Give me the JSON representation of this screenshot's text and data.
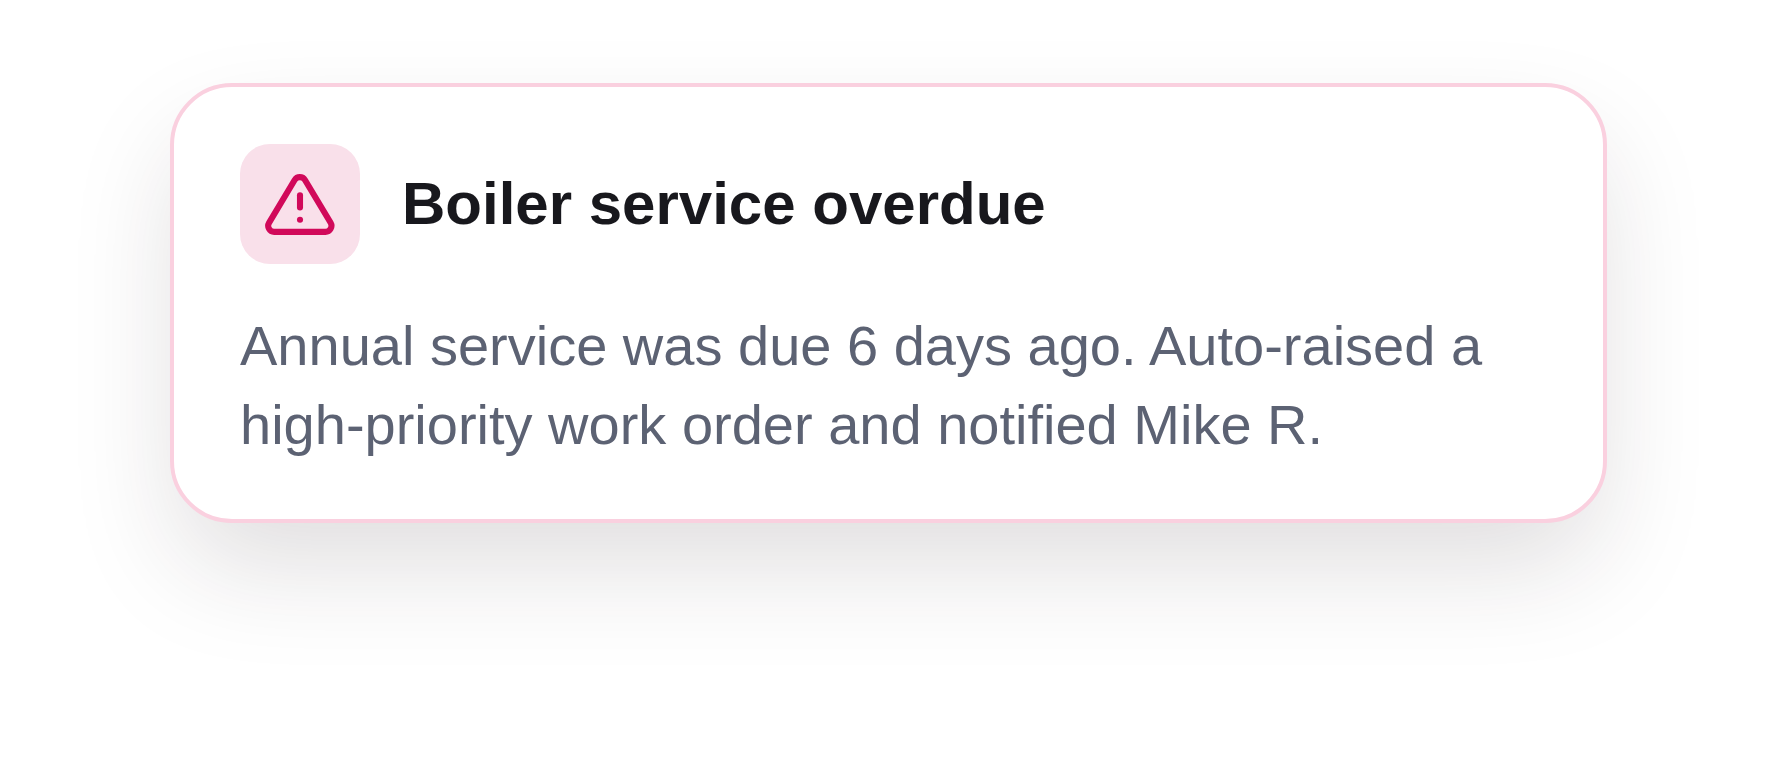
{
  "alert": {
    "title": "Boiler service overdue",
    "message": "Annual service was due 6 days ago. Auto-raised a high-priority work order and notified Mike R."
  }
}
